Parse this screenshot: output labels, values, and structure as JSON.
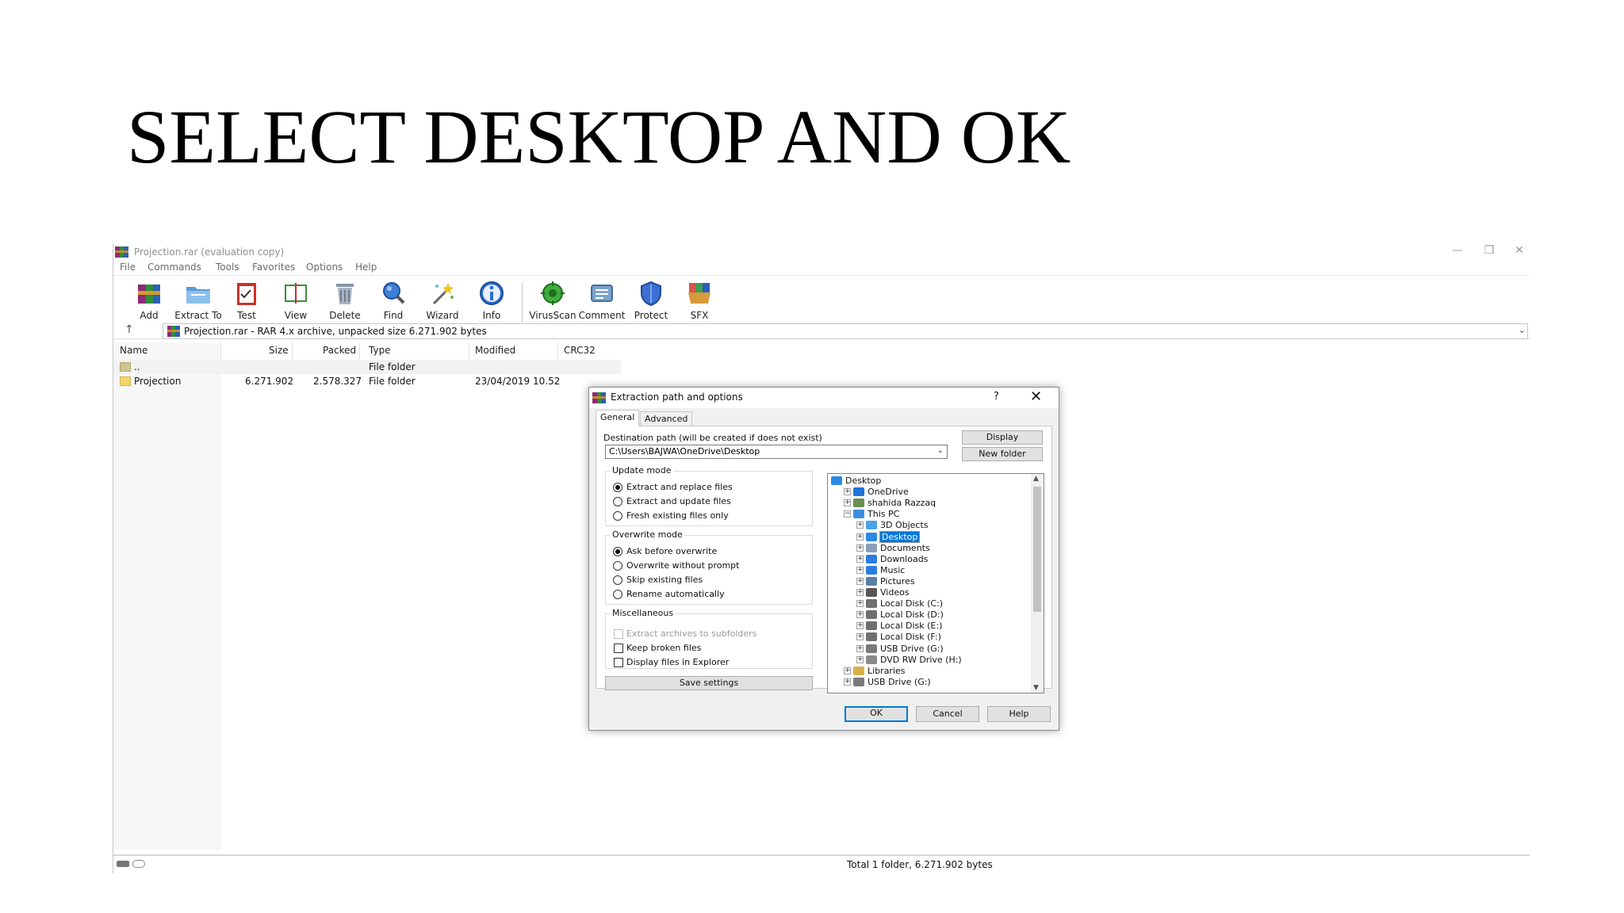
{
  "slide": {
    "title": "SELECT DESKTOP AND OK"
  },
  "window": {
    "title": "Projection.rar (evaluation copy)",
    "controls": {
      "minimize": "—",
      "restore": "❐",
      "close": "✕"
    }
  },
  "menu": [
    "File",
    "Commands",
    "Tools",
    "Favorites",
    "Options",
    "Help"
  ],
  "toolbar": [
    {
      "label": "Add",
      "icon": "add-archive-icon"
    },
    {
      "label": "Extract To",
      "icon": "extract-to-folder-icon"
    },
    {
      "label": "Test",
      "icon": "test-clipboard-icon"
    },
    {
      "label": "View",
      "icon": "view-book-icon"
    },
    {
      "label": "Delete",
      "icon": "trash-bin-icon"
    },
    {
      "label": "Find",
      "icon": "magnifier-icon"
    },
    {
      "label": "Wizard",
      "icon": "magic-wand-icon"
    },
    {
      "label": "Info",
      "icon": "info-icon"
    },
    {
      "label": "VirusScan",
      "icon": "virus-scan-icon"
    },
    {
      "label": "Comment",
      "icon": "comment-icon"
    },
    {
      "label": "Protect",
      "icon": "shield-icon"
    },
    {
      "label": "SFX",
      "icon": "sfx-box-icon"
    }
  ],
  "address": {
    "text": "Projection.rar - RAR 4.x archive, unpacked size 6.271.902 bytes"
  },
  "columns": {
    "name": "Name",
    "size": "Size",
    "packed": "Packed",
    "type": "Type",
    "modified": "Modified",
    "crc": "CRC32"
  },
  "files": [
    {
      "name": "..",
      "size": "",
      "packed": "",
      "type": "File folder",
      "modified": "",
      "crc": ""
    },
    {
      "name": "Projection",
      "size": "6.271.902",
      "packed": "2.578.327",
      "type": "File folder",
      "modified": "23/04/2019 10.52",
      "crc": ""
    }
  ],
  "status": {
    "text": "Total 1 folder, 6.271.902 bytes"
  },
  "dialog": {
    "title": "Extraction path and options",
    "help_glyph": "?",
    "close_glyph": "✕",
    "tabs": [
      "General",
      "Advanced"
    ],
    "dest_label": "Destination path (will be created if does not exist)",
    "dest_value": "C:\\Users\\BAJWA\\OneDrive\\Desktop",
    "display_btn": "Display",
    "new_folder_btn": "New folder",
    "update_mode": {
      "title": "Update mode",
      "options": [
        "Extract and replace files",
        "Extract and update files",
        "Fresh existing files only"
      ],
      "selected": 0
    },
    "overwrite_mode": {
      "title": "Overwrite mode",
      "options": [
        "Ask before overwrite",
        "Overwrite without prompt",
        "Skip existing files",
        "Rename automatically"
      ],
      "selected": 0
    },
    "misc": {
      "title": "Miscellaneous",
      "options": [
        "Extract archives to subfolders",
        "Keep broken files",
        "Display files in Explorer"
      ]
    },
    "save_settings": "Save settings",
    "tree": [
      {
        "label": "Desktop",
        "level": 0,
        "exp": "",
        "icon": "desktop-icon"
      },
      {
        "label": "OneDrive",
        "level": 1,
        "exp": "+",
        "icon": "cloud-icon"
      },
      {
        "label": "shahida Razzaq",
        "level": 1,
        "exp": "+",
        "icon": "user-icon"
      },
      {
        "label": "This PC",
        "level": 1,
        "exp": "−",
        "icon": "computer-icon"
      },
      {
        "label": "3D Objects",
        "level": 2,
        "exp": "+",
        "icon": "3d-objects-icon"
      },
      {
        "label": "Desktop",
        "level": 2,
        "exp": "+",
        "icon": "desktop-icon",
        "selected": true
      },
      {
        "label": "Documents",
        "level": 2,
        "exp": "+",
        "icon": "documents-icon"
      },
      {
        "label": "Downloads",
        "level": 2,
        "exp": "+",
        "icon": "download-arrow-icon"
      },
      {
        "label": "Music",
        "level": 2,
        "exp": "+",
        "icon": "music-note-icon"
      },
      {
        "label": "Pictures",
        "level": 2,
        "exp": "+",
        "icon": "pictures-icon"
      },
      {
        "label": "Videos",
        "level": 2,
        "exp": "+",
        "icon": "video-icon"
      },
      {
        "label": "Local Disk (C:)",
        "level": 2,
        "exp": "+",
        "icon": "drive-icon"
      },
      {
        "label": "Local Disk (D:)",
        "level": 2,
        "exp": "+",
        "icon": "drive-icon"
      },
      {
        "label": "Local Disk (E:)",
        "level": 2,
        "exp": "+",
        "icon": "drive-icon"
      },
      {
        "label": "Local Disk (F:)",
        "level": 2,
        "exp": "+",
        "icon": "drive-icon"
      },
      {
        "label": "USB Drive (G:)",
        "level": 2,
        "exp": "+",
        "icon": "usb-drive-icon"
      },
      {
        "label": "DVD RW Drive (H:)",
        "level": 2,
        "exp": "+",
        "icon": "dvd-drive-icon"
      },
      {
        "label": "Libraries",
        "level": 1,
        "exp": "+",
        "icon": "libraries-icon"
      },
      {
        "label": "USB Drive (G:)",
        "level": 1,
        "exp": "+",
        "icon": "usb-drive-icon"
      }
    ],
    "ok": "OK",
    "cancel": "Cancel",
    "help": "Help"
  }
}
